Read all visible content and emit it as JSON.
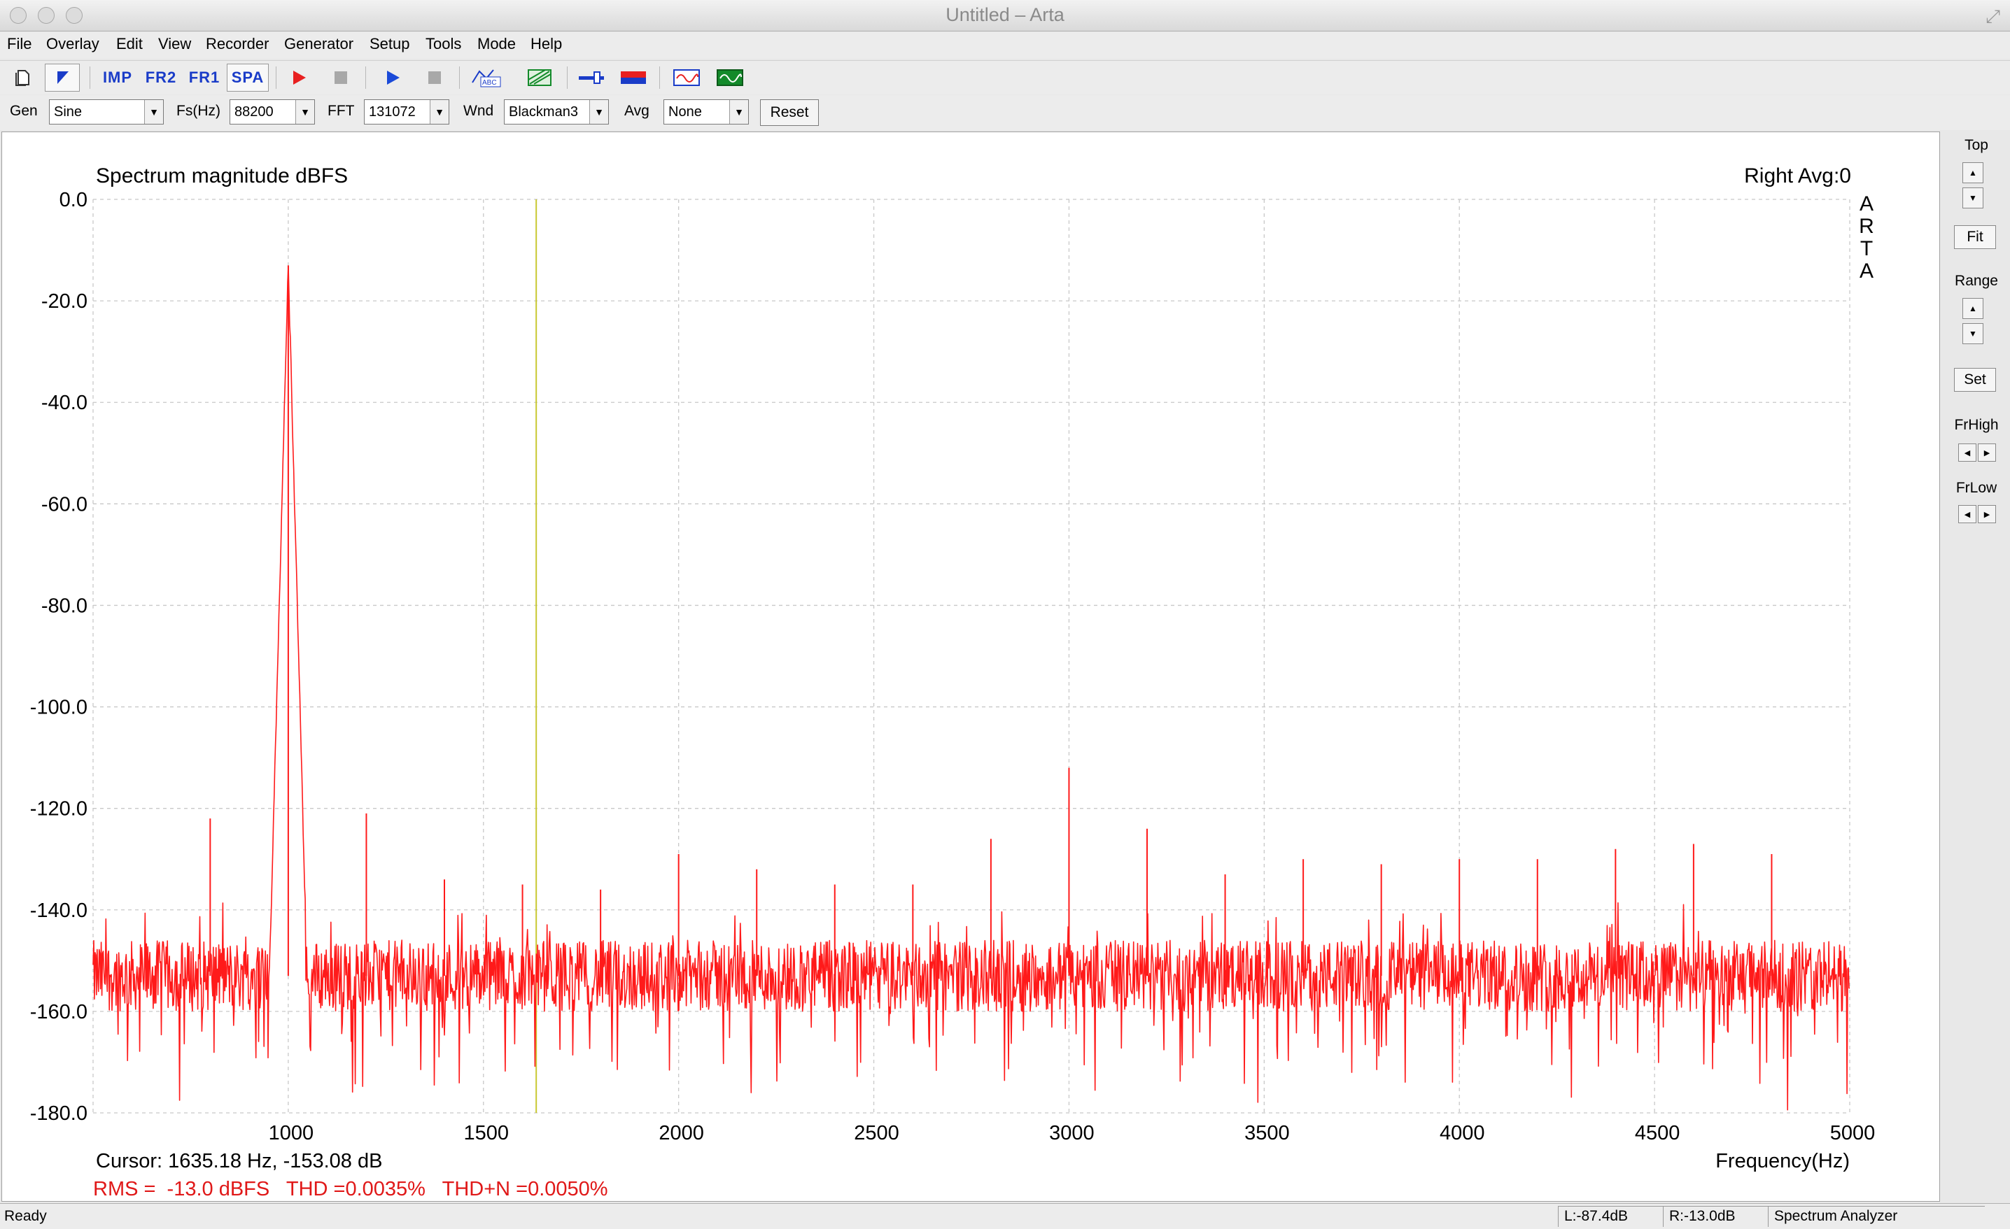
{
  "window": {
    "title": "Untitled – Arta"
  },
  "menu": {
    "items": [
      "File",
      "Overlay",
      "Edit",
      "View",
      "Recorder",
      "Generator",
      "Setup",
      "Tools",
      "Mode",
      "Help"
    ]
  },
  "toolbar": {
    "imp_label": "IMP",
    "fr2_label": "FR2",
    "fr1_label": "FR1",
    "spa_label": "SPA"
  },
  "params": {
    "gen_label": "Gen",
    "gen_value": "Sine",
    "fs_label": "Fs(Hz)",
    "fs_value": "88200",
    "fft_label": "FFT",
    "fft_value": "131072",
    "wnd_label": "Wnd",
    "wnd_value": "Blackman3",
    "avg_label": "Avg",
    "avg_value": "None",
    "reset_label": "Reset"
  },
  "plot": {
    "title": "Spectrum magnitude dBFS",
    "channel_info": "Right  Avg:0",
    "watermark": "ARTA",
    "xlabel": "Frequency(Hz)",
    "cursor_text": "Cursor: 1635.18 Hz, -153.08 dB",
    "stats_text": "RMS =  -13.0 dBFS   THD =0.0035%   THD+N =0.0050%",
    "cursor_hz": 1635.18
  },
  "side_panel": {
    "top_label": "Top",
    "fit_label": "Fit",
    "range_label": "Range",
    "set_label": "Set",
    "frhigh_label": "FrHigh",
    "frlow_label": "FrLow"
  },
  "status": {
    "ready": "Ready",
    "left_level": "L:-87.4dB",
    "right_level": "R:-13.0dB",
    "mode": "Spectrum Analyzer"
  },
  "colors": {
    "trace": "#ff1a1a",
    "cursor": "#c8c832",
    "stats": "#e01818"
  },
  "chart_data": {
    "type": "line",
    "title": "Spectrum magnitude dBFS",
    "xlabel": "Frequency(Hz)",
    "ylabel": "",
    "xlim": [
      500,
      5000
    ],
    "ylim": [
      -180,
      0
    ],
    "xticks": [
      1000,
      1500,
      2000,
      2500,
      3000,
      3500,
      4000,
      4500,
      5000
    ],
    "yticks": [
      0,
      -20,
      -40,
      -60,
      -80,
      -100,
      -120,
      -140,
      -160,
      -180
    ],
    "ytick_labels": [
      "0.0",
      "-20.0",
      "-40.0",
      "-60.0",
      "-80.0",
      "-100.0",
      "-120.0",
      "-140.0",
      "-160.0",
      "-180.0"
    ],
    "grid": true,
    "noise_floor_db": -153,
    "series": [
      {
        "peaks": [
          {
            "x": 1000,
            "y": -13.0
          },
          {
            "x": 800,
            "y": -122
          },
          {
            "x": 1200,
            "y": -121
          },
          {
            "x": 1400,
            "y": -134
          },
          {
            "x": 1600,
            "y": -135
          },
          {
            "x": 1800,
            "y": -136
          },
          {
            "x": 2000,
            "y": -129
          },
          {
            "x": 2200,
            "y": -132
          },
          {
            "x": 2400,
            "y": -135
          },
          {
            "x": 2600,
            "y": -135
          },
          {
            "x": 2800,
            "y": -126
          },
          {
            "x": 3000,
            "y": -112
          },
          {
            "x": 3200,
            "y": -124
          },
          {
            "x": 3400,
            "y": -133
          },
          {
            "x": 3600,
            "y": -130
          },
          {
            "x": 3800,
            "y": -131
          },
          {
            "x": 4000,
            "y": -130
          },
          {
            "x": 4200,
            "y": -130
          },
          {
            "x": 4400,
            "y": -128
          },
          {
            "x": 4600,
            "y": -127
          },
          {
            "x": 4800,
            "y": -129
          }
        ]
      }
    ]
  }
}
